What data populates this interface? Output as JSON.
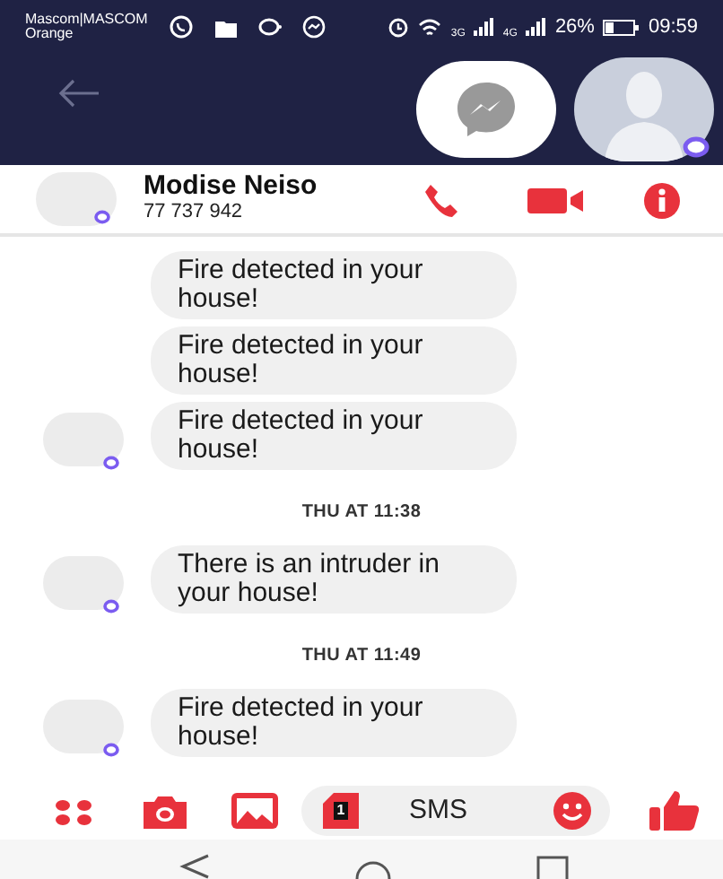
{
  "status_bar": {
    "carrier_lines": [
      "Mascom|MASCOM",
      "Orange"
    ],
    "network_labels": [
      "3G",
      "4G"
    ],
    "battery": "26%",
    "time": "09:59"
  },
  "contact": {
    "name": "Modise Neiso",
    "phone": "77 737 942"
  },
  "messages": [
    {
      "kind": "message",
      "text": "Fire detected in your house!",
      "avatar": false
    },
    {
      "kind": "message",
      "text": "Fire detected in your house!",
      "avatar": false
    },
    {
      "kind": "message",
      "text": "Fire detected in your house!",
      "avatar": true
    },
    {
      "kind": "date",
      "text": "THU AT 11:38"
    },
    {
      "kind": "message",
      "text": "There is an intruder in your house!",
      "avatar": true
    },
    {
      "kind": "date",
      "text": "THU AT 11:49"
    },
    {
      "kind": "message",
      "text": "Fire detected in your house!",
      "avatar": true
    }
  ],
  "composer": {
    "sim_badge": "1",
    "label": "SMS"
  }
}
